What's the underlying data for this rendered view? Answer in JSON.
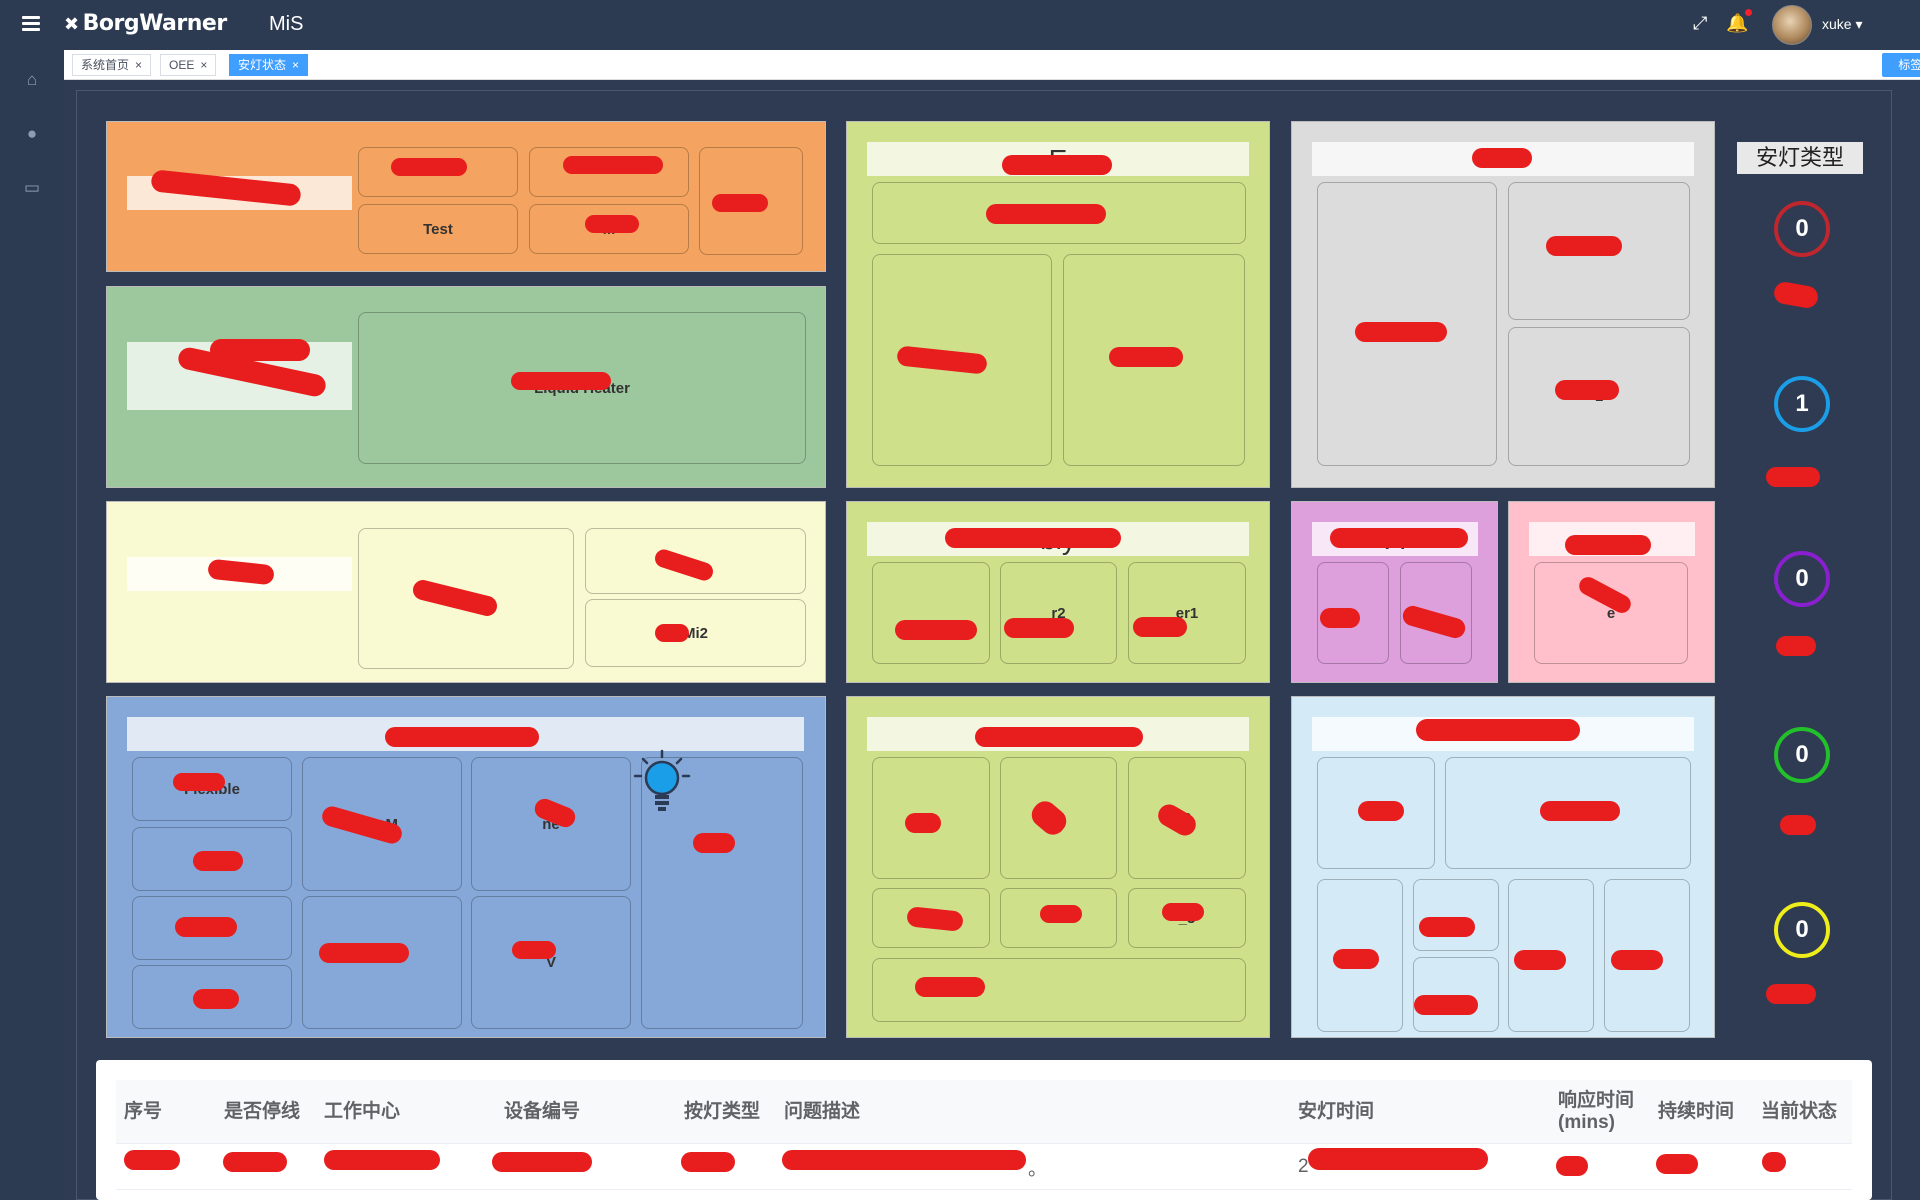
{
  "header": {
    "logo_text": "BorgWarner",
    "app_name": "MiS",
    "username": "xuke",
    "icons": [
      "menu-icon",
      "fullscreen-icon",
      "bell-icon",
      "caret-down-icon"
    ]
  },
  "sidebar": {
    "items": [
      {
        "icon": "home-icon"
      },
      {
        "icon": "bulb-icon"
      },
      {
        "icon": "cart-icon"
      }
    ]
  },
  "tabs": {
    "items": [
      {
        "label": "系统首页",
        "active": false
      },
      {
        "label": "OEE",
        "active": false
      },
      {
        "label": "安灯状态",
        "active": true
      }
    ],
    "close_glyph": "×",
    "options_label": "标签选项"
  },
  "areas": {
    "a1": {
      "title": "",
      "cells": [
        "",
        "",
        "",
        "Test",
        "M",
        ""
      ]
    },
    "a2": {
      "title": "",
      "cells": [
        "Liquid Heater"
      ]
    },
    "a3": {
      "title": "E",
      "cells": [
        "g",
        "2",
        ""
      ]
    },
    "a4": {
      "title": "",
      "cells": [
        "",
        "",
        "1"
      ]
    },
    "a5": {
      "title": "",
      "cells": [
        "2",
        "",
        "Mi2"
      ]
    },
    "a6": {
      "title": "bly",
      "cells": [
        "",
        "r2",
        "er1"
      ]
    },
    "a7": {
      "title": "A",
      "cells": [
        "",
        ""
      ]
    },
    "a8": {
      "title": "",
      "cells": [
        "e"
      ]
    },
    "a9": {
      "title": "",
      "cells": [
        "Flexible",
        "",
        "",
        "",
        "A+M",
        "ne",
        "",
        "V",
        ""
      ]
    },
    "a10": {
      "title": "",
      "cells": [
        "1",
        "2",
        "3",
        "",
        "2",
        "_3",
        ""
      ]
    },
    "a11": {
      "title": "",
      "cells": [
        "",
        "",
        "",
        "",
        "",
        "",
        ""
      ]
    }
  },
  "legend": {
    "title": "安灯类型",
    "counters": [
      {
        "value": "0",
        "label": "",
        "color": "#c0262d"
      },
      {
        "value": "1",
        "label": "",
        "color": "#1a9ee8"
      },
      {
        "value": "0",
        "label": "",
        "color": "#8a1fd0"
      },
      {
        "value": "0",
        "label": "",
        "color": "#22c02b"
      },
      {
        "value": "0",
        "label": "",
        "color": "#f0ee1a"
      }
    ]
  },
  "table": {
    "headers": [
      "序号",
      "是否停线",
      "工作中心",
      "设备编号",
      "按灯类型",
      "问题描述",
      "安灯时间",
      "响应时间\n(mins)",
      "持续时间",
      "当前状态"
    ],
    "rows": [
      [
        "",
        "",
        "",
        "",
        "",
        "。",
        "2",
        "",
        "",
        ""
      ]
    ]
  }
}
